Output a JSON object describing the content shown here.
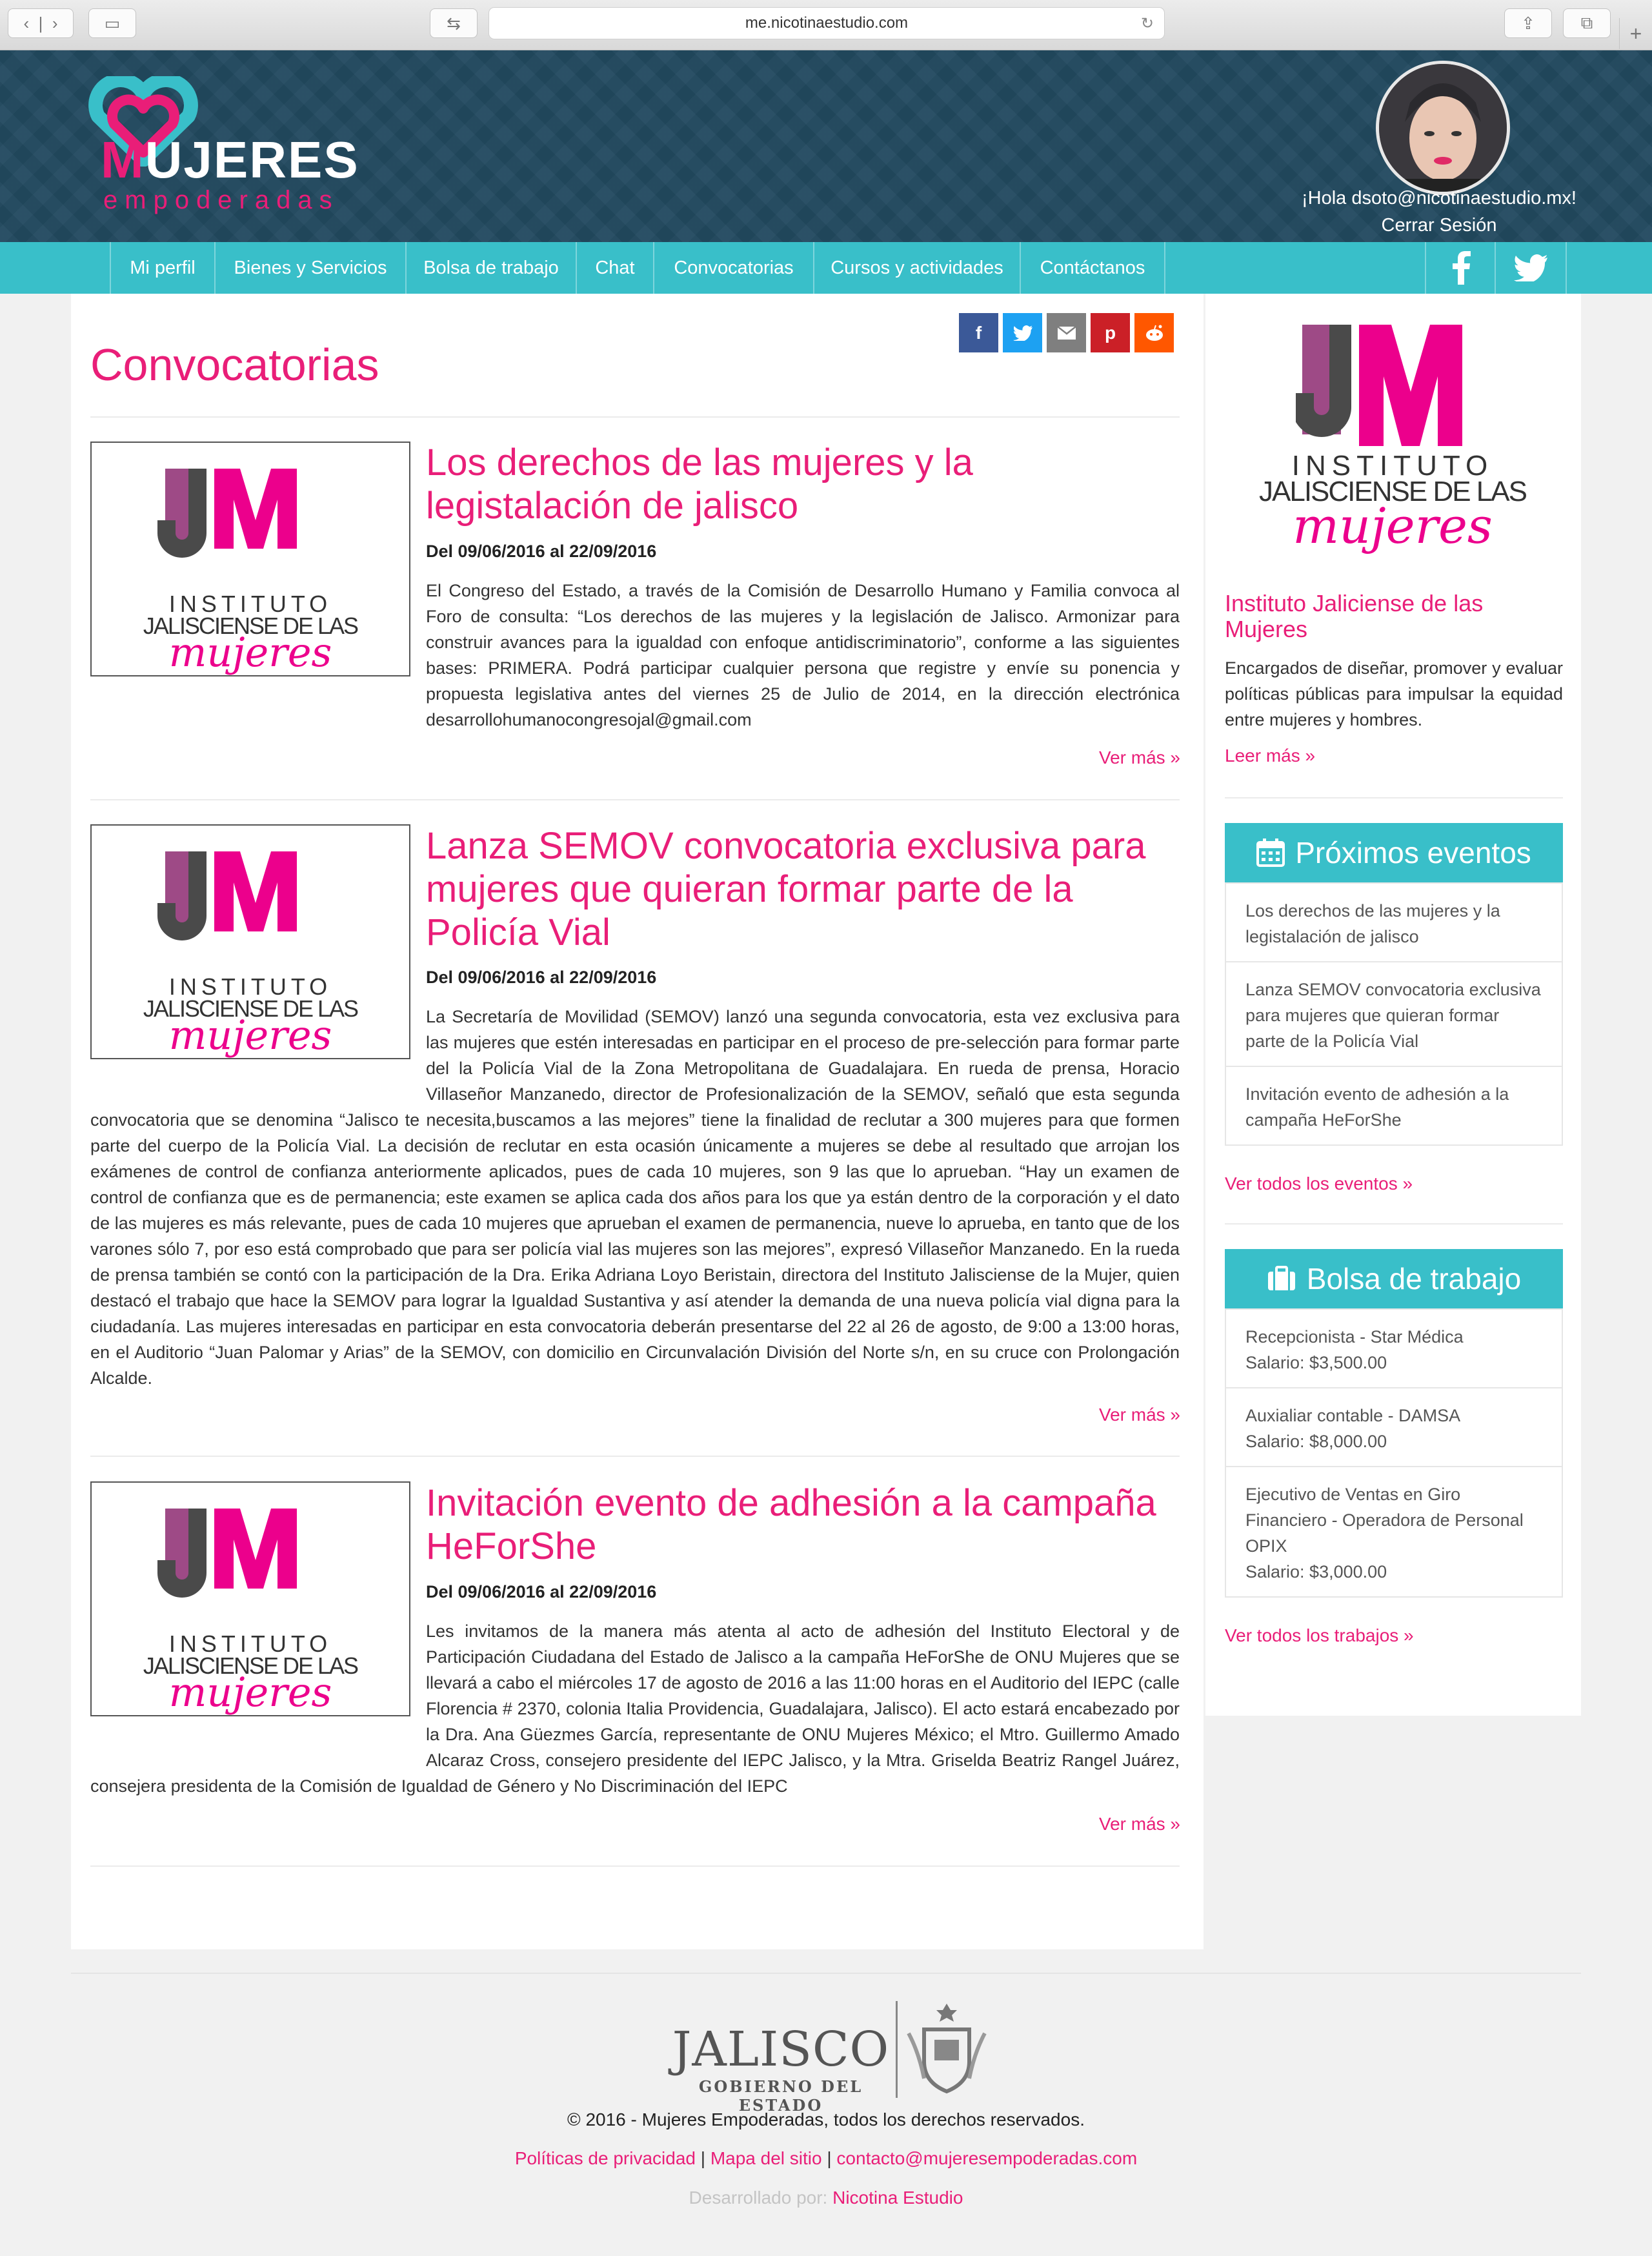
{
  "browser": {
    "url": "me.nicotinaestudio.com"
  },
  "brand": {
    "name_m": "M",
    "name_rest": "UJERES",
    "subtitle": "empoderadas"
  },
  "user": {
    "greeting": "¡Hola dsoto@nicotinaestudio.mx!",
    "logout": "Cerrar Sesión"
  },
  "nav": {
    "items": [
      "Mi perfil",
      "Bienes y Servicios",
      "Bolsa de trabajo",
      "Chat",
      "Convocatorias",
      "Cursos y actividades",
      "Contáctanos"
    ]
  },
  "page": {
    "title": "Convocatorias"
  },
  "logo_um": {
    "letters": "UM",
    "line1": "INSTITUTO",
    "line2": "JALISCIENSE DE LAS",
    "line3": "mujeres"
  },
  "articles": [
    {
      "title": "Los derechos de las mujeres y la legistalación de jalisco",
      "date": "Del 09/06/2016 al 22/09/2016",
      "body": "El Congreso del Estado, a través de la Comisión de Desarrollo Humano y Familia convoca al Foro de consulta: “Los derechos de las mujeres y la legislación de Jalisco. Armonizar para construir avances para la igualdad con enfoque antidiscriminatorio”, conforme a las siguientes bases: PRIMERA. Podrá participar cualquier persona que registre y envíe su ponencia y propuesta legislativa antes del viernes 25 de Julio de 2014, en la dirección electrónica desarrollohumanocongresojal@gmail.com",
      "more": "Ver más »"
    },
    {
      "title": "Lanza SEMOV convocatoria exclusiva para mujeres que quieran formar parte de la Policía Vial",
      "date": "Del 09/06/2016 al 22/09/2016",
      "body": "La Secretaría de Movilidad (SEMOV) lanzó una segunda convocatoria, esta vez exclusiva para las mujeres que estén interesadas en participar en el proceso de pre-selección para formar parte del la Policía Vial de la Zona Metropolitana de Guadalajara. En rueda de prensa, Horacio Villaseñor Manzanedo, director de Profesionalización de la SEMOV, señaló que esta segunda convocatoria que se denomina “Jalisco te necesita,buscamos a las mejores” tiene la finalidad de reclutar a 300 mujeres para que formen parte del cuerpo de la Policía Vial. La decisión de reclutar en esta ocasión únicamente a mujeres se debe al resultado que arrojan los exámenes de control de confianza anteriormente aplicados, pues de cada 10 mujeres, son 9 las que lo aprueban. “Hay un examen de control de confianza que es de permanencia; este examen se aplica cada dos años para los que ya están dentro de la corporación y el dato de las mujeres es más relevante, pues de cada 10 mujeres que aprueban el examen de permanencia, nueve lo aprueba, en tanto que de los varones sólo 7, por eso está comprobado que para ser policía vial las mujeres son las mejores”, expresó Villaseñor Manzanedo. En la rueda de prensa también se contó con la participación de la Dra. Erika Adriana Loyo Beristain, directora del Instituto Jalisciense de la Mujer, quien destacó el trabajo que hace la SEMOV para lograr la Igualdad Sustantiva y así atender la demanda de una nueva policía vial digna para la ciudadanía. Las mujeres interesadas en participar en esta convocatoria deberán presentarse del 22 al 26 de agosto, de 9:00 a 13:00 horas, en el Auditorio “Juan Palomar y Arias” de la SEMOV, con domicilio en Circunvalación División del Norte s/n, en su cruce con Prolongación Alcalde.",
      "more": "Ver más »"
    },
    {
      "title": "Invitación evento de adhesión a la campaña HeForShe",
      "date": "Del 09/06/2016 al 22/09/2016",
      "body": "Les invitamos de la manera más atenta al acto de adhesión del Instituto Electoral y de Participación Ciudadana del Estado de Jalisco a la campaña HeForShe de ONU Mujeres que se llevará a cabo el miércoles 17 de agosto de 2016 a las 11:00 horas en el Auditorio del IEPC (calle Florencia # 2370, colonia Italia Providencia, Guadalajara, Jalisco). El acto estará encabezado por la Dra. Ana Güezmes García, representante de ONU Mujeres México; el Mtro. Guillermo Amado Alcaraz Cross, consejero presidente del IEPC Jalisco, y la Mtra. Griselda Beatriz Rangel Juárez, consejera presidenta de la Comisión de Igualdad de Género y No Discriminación del IEPC",
      "more": "Ver más »"
    }
  ],
  "sidebar": {
    "institute": {
      "title": "Instituto Jaliciense de las Mujeres",
      "desc": "Encargados de diseñar, promover y evaluar políticas públicas para impulsar la equidad entre mujeres y hombres.",
      "more": "Leer más »"
    },
    "events": {
      "title": "Próximos eventos",
      "items": [
        "Los derechos de las mujeres y la legistalación de jalisco",
        "Lanza SEMOV convocatoria exclusiva para mujeres que quieran formar parte de la Policía Vial",
        "Invitación evento de adhesión a la campaña HeForShe"
      ],
      "more": "Ver todos los eventos »"
    },
    "jobs": {
      "title": "Bolsa de trabajo",
      "items": [
        {
          "name": "Recepcionista - Star Médica",
          "salary": "Salario: $3,500.00"
        },
        {
          "name": "Auxialiar contable - DAMSA",
          "salary": "Salario: $8,000.00"
        },
        {
          "name": "Ejecutivo de Ventas en Giro Financiero - Operadora de Personal OPIX",
          "salary": "Salario: $3,000.00"
        }
      ],
      "more": "Ver todos los trabajos »"
    }
  },
  "footer": {
    "jalisco": "JALISCO",
    "gobierno": "GOBIERNO DEL ESTADO",
    "copyright": "© 2016 - Mujeres Empoderadas, todos los derechos reservados.",
    "links": [
      "Políticas de privacidad",
      "Mapa del sitio",
      "contacto@mujeresempoderadas.com"
    ],
    "dev_label": "Desarrollado por:",
    "dev_name": "Nicotina Estudio"
  },
  "colors": {
    "pink": "#e91e78",
    "teal": "#39bfc9",
    "navy": "#22495f"
  }
}
